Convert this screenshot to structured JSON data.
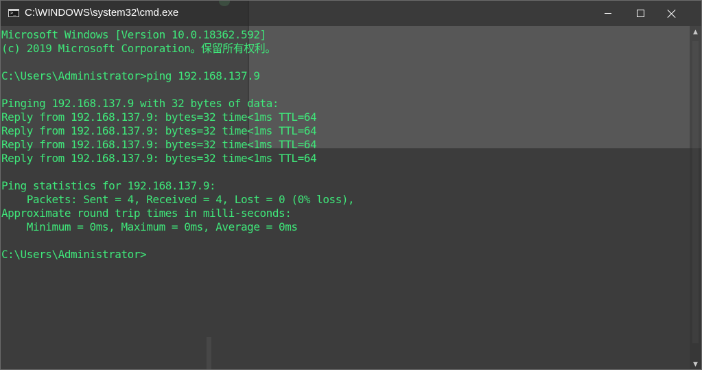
{
  "window": {
    "title": "C:\\WINDOWS\\system32\\cmd.exe",
    "icon": "console-icon"
  },
  "console": {
    "lines": [
      "Microsoft Windows [Version 10.0.18362.592]",
      "(c) 2019 Microsoft Corporation。保留所有权利。",
      "",
      "C:\\Users\\Administrator>ping 192.168.137.9",
      "",
      "Pinging 192.168.137.9 with 32 bytes of data:",
      "Reply from 192.168.137.9: bytes=32 time<1ms TTL=64",
      "Reply from 192.168.137.9: bytes=32 time<1ms TTL=64",
      "Reply from 192.168.137.9: bytes=32 time<1ms TTL=64",
      "Reply from 192.168.137.9: bytes=32 time<1ms TTL=64",
      "",
      "Ping statistics for 192.168.137.9:",
      "    Packets: Sent = 4, Received = 4, Lost = 0 (0% loss),",
      "Approximate round trip times in milli-seconds:",
      "    Minimum = 0ms, Maximum = 0ms, Average = 0ms",
      "",
      "C:\\Users\\Administrator>"
    ]
  },
  "colors": {
    "text": "#3fe87a",
    "background": "#3c3c3c"
  },
  "controls": {
    "minimize": "minimize-icon",
    "maximize": "maximize-icon",
    "close": "close-icon"
  }
}
